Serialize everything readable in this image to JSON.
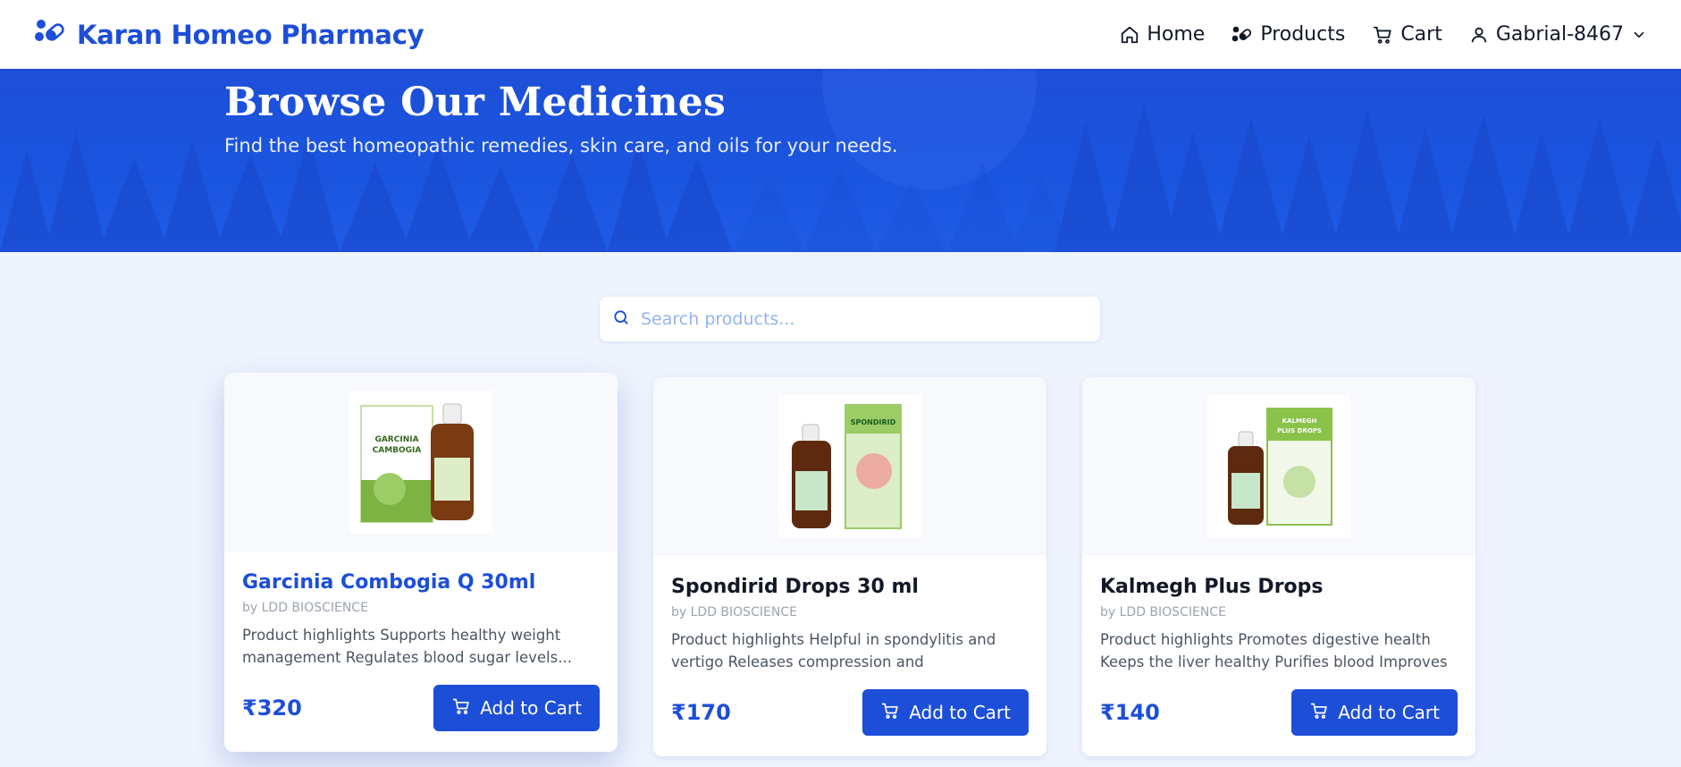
{
  "brand": {
    "name": "Karan Homeo Pharmacy",
    "icon": "pills-icon"
  },
  "nav": {
    "home": "Home",
    "products": "Products",
    "cart": "Cart",
    "user": "Gabrial-8467"
  },
  "hero": {
    "title": "Browse Our Medicines",
    "subtitle": "Find the best homeopathic remedies, skin care, and oils for your needs."
  },
  "search": {
    "placeholder": "Search products..."
  },
  "products": [
    {
      "name": "Garcinia Combogia Q 30ml",
      "brand": "by LDD BIOSCIENCE",
      "description": "Product highlights Supports healthy weight management Regulates blood sugar levels...",
      "price": "₹320",
      "button": "Add to Cart",
      "box_color": "#7cb342",
      "box_label": "GARCINIA CAMBOGIA"
    },
    {
      "name": "Spondirid Drops 30 ml",
      "brand": "by LDD BIOSCIENCE",
      "description": "Product highlights Helpful in spondylitis and vertigo Releases compression and inflammation...",
      "price": "₹170",
      "button": "Add to Cart",
      "box_color": "#9ccc65",
      "box_label": "SPONDIRID"
    },
    {
      "name": "Kalmegh Plus Drops",
      "brand": "by LDD BIOSCIENCE",
      "description": "Product highlights Promotes digestive health Keeps the liver healthy Purifies blood Improves blood...",
      "price": "₹140",
      "button": "Add to Cart",
      "box_color": "#8bc34a",
      "box_label": "KALMEGH PLUS DROPS"
    }
  ],
  "colors": {
    "primary": "#1d4ed8",
    "hero": "#1a55e0",
    "page_bg": "#eef3fd"
  }
}
